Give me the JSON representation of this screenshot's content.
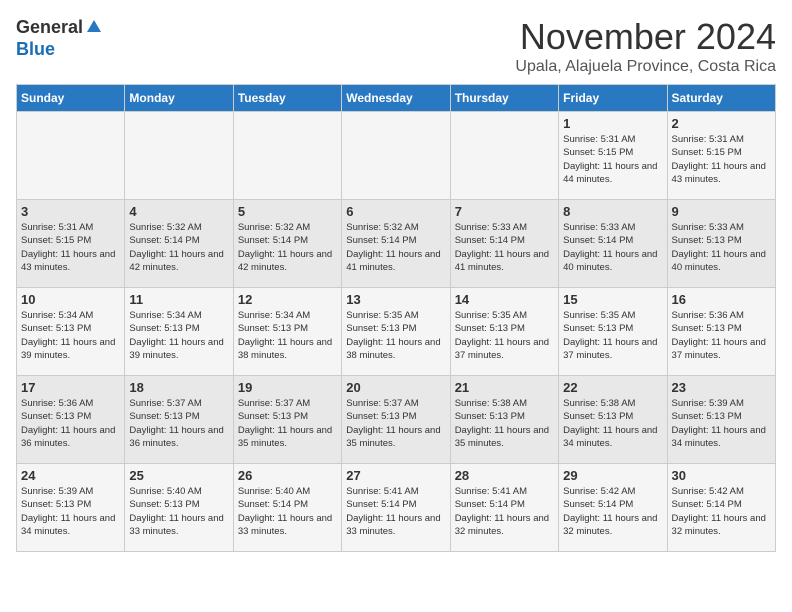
{
  "header": {
    "logo_general": "General",
    "logo_blue": "Blue",
    "month_title": "November 2024",
    "location": "Upala, Alajuela Province, Costa Rica"
  },
  "weekdays": [
    "Sunday",
    "Monday",
    "Tuesday",
    "Wednesday",
    "Thursday",
    "Friday",
    "Saturday"
  ],
  "weeks": [
    [
      {
        "day": "",
        "info": ""
      },
      {
        "day": "",
        "info": ""
      },
      {
        "day": "",
        "info": ""
      },
      {
        "day": "",
        "info": ""
      },
      {
        "day": "",
        "info": ""
      },
      {
        "day": "1",
        "info": "Sunrise: 5:31 AM\nSunset: 5:15 PM\nDaylight: 11 hours and 44 minutes."
      },
      {
        "day": "2",
        "info": "Sunrise: 5:31 AM\nSunset: 5:15 PM\nDaylight: 11 hours and 43 minutes."
      }
    ],
    [
      {
        "day": "3",
        "info": "Sunrise: 5:31 AM\nSunset: 5:15 PM\nDaylight: 11 hours and 43 minutes."
      },
      {
        "day": "4",
        "info": "Sunrise: 5:32 AM\nSunset: 5:14 PM\nDaylight: 11 hours and 42 minutes."
      },
      {
        "day": "5",
        "info": "Sunrise: 5:32 AM\nSunset: 5:14 PM\nDaylight: 11 hours and 42 minutes."
      },
      {
        "day": "6",
        "info": "Sunrise: 5:32 AM\nSunset: 5:14 PM\nDaylight: 11 hours and 41 minutes."
      },
      {
        "day": "7",
        "info": "Sunrise: 5:33 AM\nSunset: 5:14 PM\nDaylight: 11 hours and 41 minutes."
      },
      {
        "day": "8",
        "info": "Sunrise: 5:33 AM\nSunset: 5:14 PM\nDaylight: 11 hours and 40 minutes."
      },
      {
        "day": "9",
        "info": "Sunrise: 5:33 AM\nSunset: 5:13 PM\nDaylight: 11 hours and 40 minutes."
      }
    ],
    [
      {
        "day": "10",
        "info": "Sunrise: 5:34 AM\nSunset: 5:13 PM\nDaylight: 11 hours and 39 minutes."
      },
      {
        "day": "11",
        "info": "Sunrise: 5:34 AM\nSunset: 5:13 PM\nDaylight: 11 hours and 39 minutes."
      },
      {
        "day": "12",
        "info": "Sunrise: 5:34 AM\nSunset: 5:13 PM\nDaylight: 11 hours and 38 minutes."
      },
      {
        "day": "13",
        "info": "Sunrise: 5:35 AM\nSunset: 5:13 PM\nDaylight: 11 hours and 38 minutes."
      },
      {
        "day": "14",
        "info": "Sunrise: 5:35 AM\nSunset: 5:13 PM\nDaylight: 11 hours and 37 minutes."
      },
      {
        "day": "15",
        "info": "Sunrise: 5:35 AM\nSunset: 5:13 PM\nDaylight: 11 hours and 37 minutes."
      },
      {
        "day": "16",
        "info": "Sunrise: 5:36 AM\nSunset: 5:13 PM\nDaylight: 11 hours and 37 minutes."
      }
    ],
    [
      {
        "day": "17",
        "info": "Sunrise: 5:36 AM\nSunset: 5:13 PM\nDaylight: 11 hours and 36 minutes."
      },
      {
        "day": "18",
        "info": "Sunrise: 5:37 AM\nSunset: 5:13 PM\nDaylight: 11 hours and 36 minutes."
      },
      {
        "day": "19",
        "info": "Sunrise: 5:37 AM\nSunset: 5:13 PM\nDaylight: 11 hours and 35 minutes."
      },
      {
        "day": "20",
        "info": "Sunrise: 5:37 AM\nSunset: 5:13 PM\nDaylight: 11 hours and 35 minutes."
      },
      {
        "day": "21",
        "info": "Sunrise: 5:38 AM\nSunset: 5:13 PM\nDaylight: 11 hours and 35 minutes."
      },
      {
        "day": "22",
        "info": "Sunrise: 5:38 AM\nSunset: 5:13 PM\nDaylight: 11 hours and 34 minutes."
      },
      {
        "day": "23",
        "info": "Sunrise: 5:39 AM\nSunset: 5:13 PM\nDaylight: 11 hours and 34 minutes."
      }
    ],
    [
      {
        "day": "24",
        "info": "Sunrise: 5:39 AM\nSunset: 5:13 PM\nDaylight: 11 hours and 34 minutes."
      },
      {
        "day": "25",
        "info": "Sunrise: 5:40 AM\nSunset: 5:13 PM\nDaylight: 11 hours and 33 minutes."
      },
      {
        "day": "26",
        "info": "Sunrise: 5:40 AM\nSunset: 5:14 PM\nDaylight: 11 hours and 33 minutes."
      },
      {
        "day": "27",
        "info": "Sunrise: 5:41 AM\nSunset: 5:14 PM\nDaylight: 11 hours and 33 minutes."
      },
      {
        "day": "28",
        "info": "Sunrise: 5:41 AM\nSunset: 5:14 PM\nDaylight: 11 hours and 32 minutes."
      },
      {
        "day": "29",
        "info": "Sunrise: 5:42 AM\nSunset: 5:14 PM\nDaylight: 11 hours and 32 minutes."
      },
      {
        "day": "30",
        "info": "Sunrise: 5:42 AM\nSunset: 5:14 PM\nDaylight: 11 hours and 32 minutes."
      }
    ]
  ]
}
